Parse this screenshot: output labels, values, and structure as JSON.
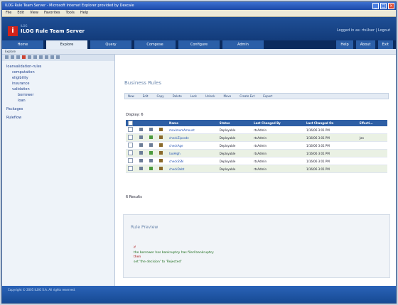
{
  "window": {
    "title": "ILOG Rule Team Server - Microsoft Internet Explorer provided by Dexcale"
  },
  "menu": [
    "File",
    "Edit",
    "View",
    "Favorites",
    "Tools",
    "Help"
  ],
  "app": {
    "brand": "ILOG",
    "name": "ILOG Rule Team Server",
    "links": "Logged in as: rtsUser  |  Logout"
  },
  "tabs": [
    "Home",
    "Explore",
    "Query",
    "Compose",
    "Configure",
    "Admin"
  ],
  "tabs_right": [
    "Help",
    "About",
    "Exit"
  ],
  "breadcrumb": "Explore",
  "sidebar": {
    "tree": [
      {
        "label": "loanvalidation-rules",
        "level": 0
      },
      {
        "label": "computation",
        "level": 1
      },
      {
        "label": "eligibility",
        "level": 1
      },
      {
        "label": "insurance",
        "level": 1
      },
      {
        "label": "validation",
        "level": 1
      },
      {
        "label": "borrower",
        "level": 2
      },
      {
        "label": "loan",
        "level": 2
      },
      {
        "label": "Packages",
        "level": 0
      },
      {
        "label": "Ruleflow",
        "level": 0
      }
    ]
  },
  "main": {
    "title": "Business Rules",
    "toolbar": [
      "New",
      "Edit",
      "Copy",
      "Delete",
      "Lock",
      "Unlock",
      "Move",
      "Create Ext",
      "Export"
    ],
    "display_label": "Display: 6",
    "columns": [
      "Name",
      "Status",
      "Last Changed By",
      "Last Changed On",
      "Effecti..."
    ],
    "rows": [
      {
        "name": "maximumAmount",
        "status": "Deployable",
        "by": "rtsAdmin",
        "on": "1/16/06 3:01 PM",
        "eff": ""
      },
      {
        "name": "checkZipcode",
        "status": "Deployable",
        "by": "rtsAdmin",
        "on": "1/16/06 3:01 PM",
        "eff": "Jan"
      },
      {
        "name": "checkAge",
        "status": "Deployable",
        "by": "rtsAdmin",
        "on": "1/16/06 3:01 PM",
        "eff": ""
      },
      {
        "name": "tooHigh",
        "status": "Deployable",
        "by": "rtsAdmin",
        "on": "1/16/06 3:01 PM",
        "eff": ""
      },
      {
        "name": "checkSSN",
        "status": "Deployable",
        "by": "rtsAdmin",
        "on": "1/16/06 3:01 PM",
        "eff": ""
      },
      {
        "name": "checkDebt",
        "status": "Deployable",
        "by": "rtsAdmin",
        "on": "1/16/06 3:01 PM",
        "eff": ""
      }
    ],
    "count_text": "6 Results"
  },
  "promo": {
    "heading": "Rule Preview",
    "line1_prefix": "if",
    "line2": "the borrower has bankruptcy  has filed bankruptcy",
    "line3_prefix": "then",
    "line4": "set 'the decision' to 'Rejected'"
  },
  "footer": {
    "text": "Copyright © 2005 ILOG S.A. All rights reserved."
  }
}
